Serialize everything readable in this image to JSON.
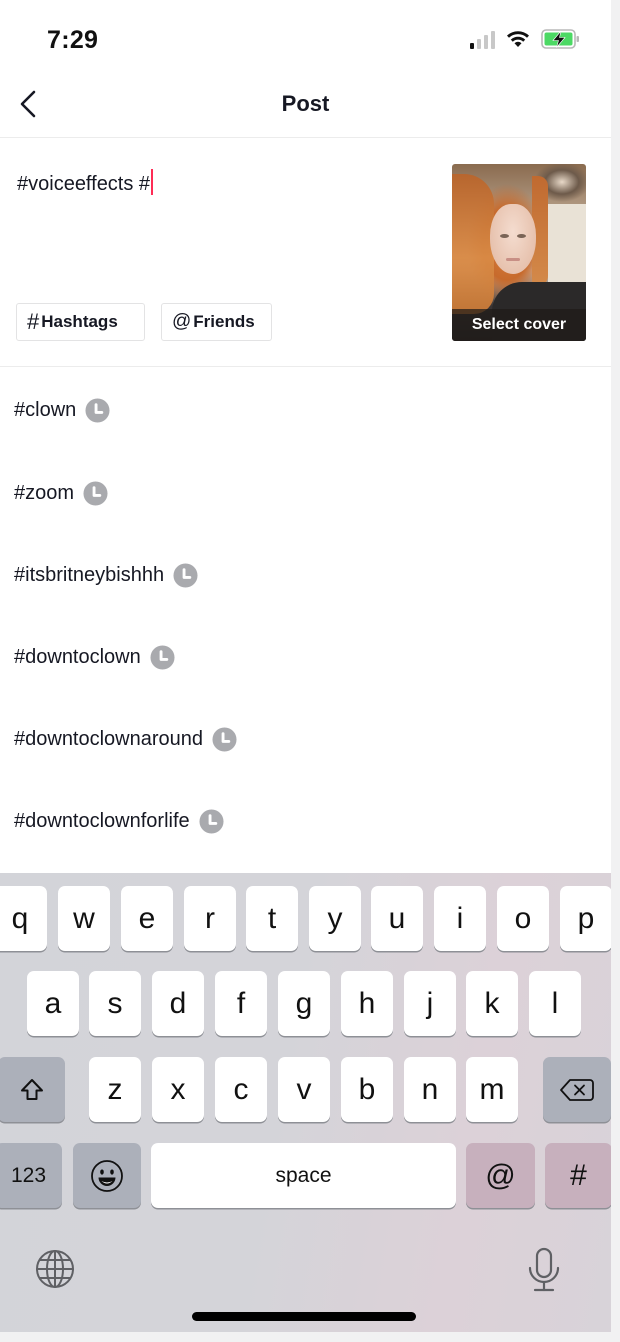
{
  "status_bar": {
    "time": "7:29",
    "signal_bars": 1,
    "signal_max": 4,
    "wifi": "wifi-icon",
    "battery": "battery-charging-icon",
    "battery_color": "#4cd964"
  },
  "nav": {
    "back_icon": "chevron-left-icon",
    "title": "Post"
  },
  "caption": {
    "text": "#voiceeffects #",
    "caret_color": "#fe2c55"
  },
  "chips": {
    "hashtags": {
      "symbol": "#",
      "label": "Hashtags"
    },
    "friends": {
      "symbol": "@",
      "label": "Friends"
    }
  },
  "cover": {
    "label": "Select cover"
  },
  "suggestions": [
    {
      "tag": "#clown",
      "icon": "recent-clock-icon"
    },
    {
      "tag": "#zoom",
      "icon": "recent-clock-icon"
    },
    {
      "tag": "#itsbritneybishhh",
      "icon": "recent-clock-icon"
    },
    {
      "tag": "#downtoclown",
      "icon": "recent-clock-icon"
    },
    {
      "tag": "#downtoclownaround",
      "icon": "recent-clock-icon"
    },
    {
      "tag": "#downtoclownforlife",
      "icon": "recent-clock-icon"
    }
  ],
  "keyboard": {
    "row1": [
      "q",
      "w",
      "e",
      "r",
      "t",
      "y",
      "u",
      "i",
      "o",
      "p"
    ],
    "row2": [
      "a",
      "s",
      "d",
      "f",
      "g",
      "h",
      "j",
      "k",
      "l"
    ],
    "row3": [
      "z",
      "x",
      "c",
      "v",
      "b",
      "n",
      "m"
    ],
    "numbers_label": "123",
    "space_label": "space",
    "at_label": "@",
    "hash_label": "#",
    "shift_icon": "shift-icon",
    "delete_icon": "backspace-icon",
    "emoji_icon": "emoji-icon",
    "globe_icon": "globe-icon",
    "mic_icon": "microphone-icon"
  }
}
